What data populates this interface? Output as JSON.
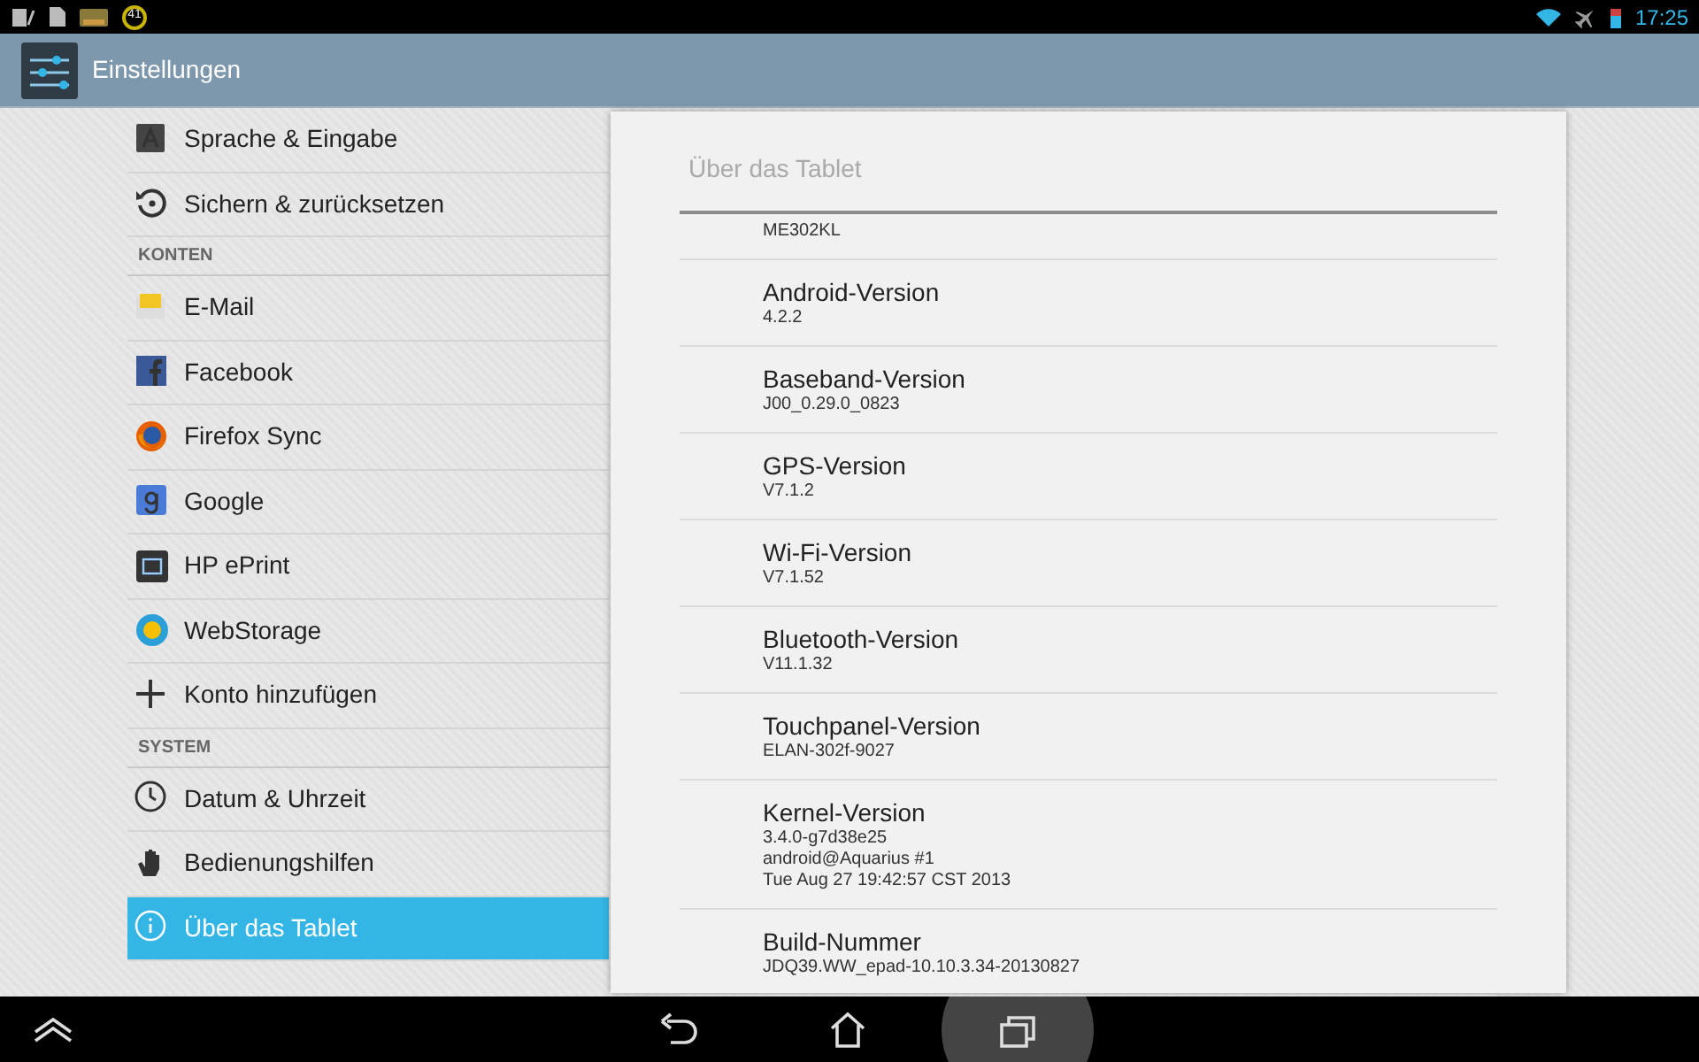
{
  "status_bar": {
    "notification_count": "41",
    "time": "17:25"
  },
  "action_bar": {
    "title": "Einstellungen"
  },
  "sidebar": {
    "items": [
      {
        "kind": "item",
        "label": "Sprache & Eingabe",
        "selected": false
      },
      {
        "kind": "item",
        "label": "Sichern & zurücksetzen",
        "selected": false
      },
      {
        "kind": "header",
        "label": "KONTEN"
      },
      {
        "kind": "item",
        "label": "E-Mail",
        "selected": false
      },
      {
        "kind": "item",
        "label": "Facebook",
        "selected": false
      },
      {
        "kind": "item",
        "label": "Firefox Sync",
        "selected": false
      },
      {
        "kind": "item",
        "label": "Google",
        "selected": false
      },
      {
        "kind": "item",
        "label": "HP ePrint",
        "selected": false
      },
      {
        "kind": "item",
        "label": "WebStorage",
        "selected": false
      },
      {
        "kind": "item",
        "label": "Konto hinzufügen",
        "selected": false
      },
      {
        "kind": "header",
        "label": "SYSTEM"
      },
      {
        "kind": "item",
        "label": "Datum & Uhrzeit",
        "selected": false
      },
      {
        "kind": "item",
        "label": "Bedienungshilfen",
        "selected": false
      },
      {
        "kind": "item",
        "label": "Über das Tablet",
        "selected": true
      }
    ]
  },
  "detail": {
    "title": "Über das Tablet",
    "items": [
      {
        "summary": [
          "ME302KL"
        ]
      },
      {
        "title": "Android-Version",
        "summary": [
          "4.2.2"
        ]
      },
      {
        "title": "Baseband-Version",
        "summary": [
          "J00_0.29.0_0823"
        ]
      },
      {
        "title": "GPS-Version",
        "summary": [
          "V7.1.2"
        ]
      },
      {
        "title": "Wi-Fi-Version",
        "summary": [
          "V7.1.52"
        ]
      },
      {
        "title": "Bluetooth-Version",
        "summary": [
          "V11.1.32"
        ]
      },
      {
        "title": "Touchpanel-Version",
        "summary": [
          "ELAN-302f-9027"
        ]
      },
      {
        "title": "Kernel-Version",
        "summary": [
          "3.4.0-g7d38e25",
          "android@Aquarius #1",
          "Tue Aug 27 19:42:57 CST 2013"
        ]
      },
      {
        "title": "Build-Nummer",
        "summary": [
          "JDQ39.WW_epad-10.10.3.34-20130827"
        ]
      }
    ]
  }
}
